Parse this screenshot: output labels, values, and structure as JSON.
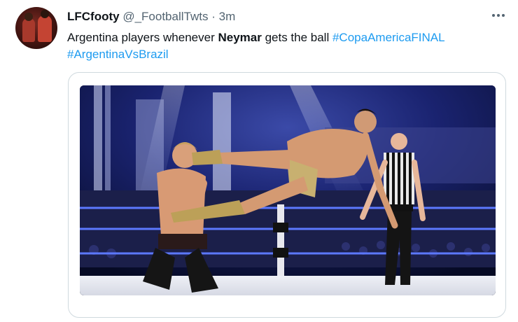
{
  "tweet": {
    "author_name": "LFCfooty",
    "author_handle": "@_FootballTwts",
    "separator": "·",
    "time": "3m",
    "text_before": "Argentina players whenever ",
    "text_bold": "Neymar",
    "text_after": " gets the ball ",
    "hashtag_1": "#CopaAmericaFINAL",
    "hashtag_2": "#ArgentinaVsBrazil"
  },
  "icons": {
    "more": "more-horizontal-icon"
  },
  "colors": {
    "link": "#1d9bf0",
    "secondary_text": "#536471",
    "border": "#cfd9de"
  }
}
